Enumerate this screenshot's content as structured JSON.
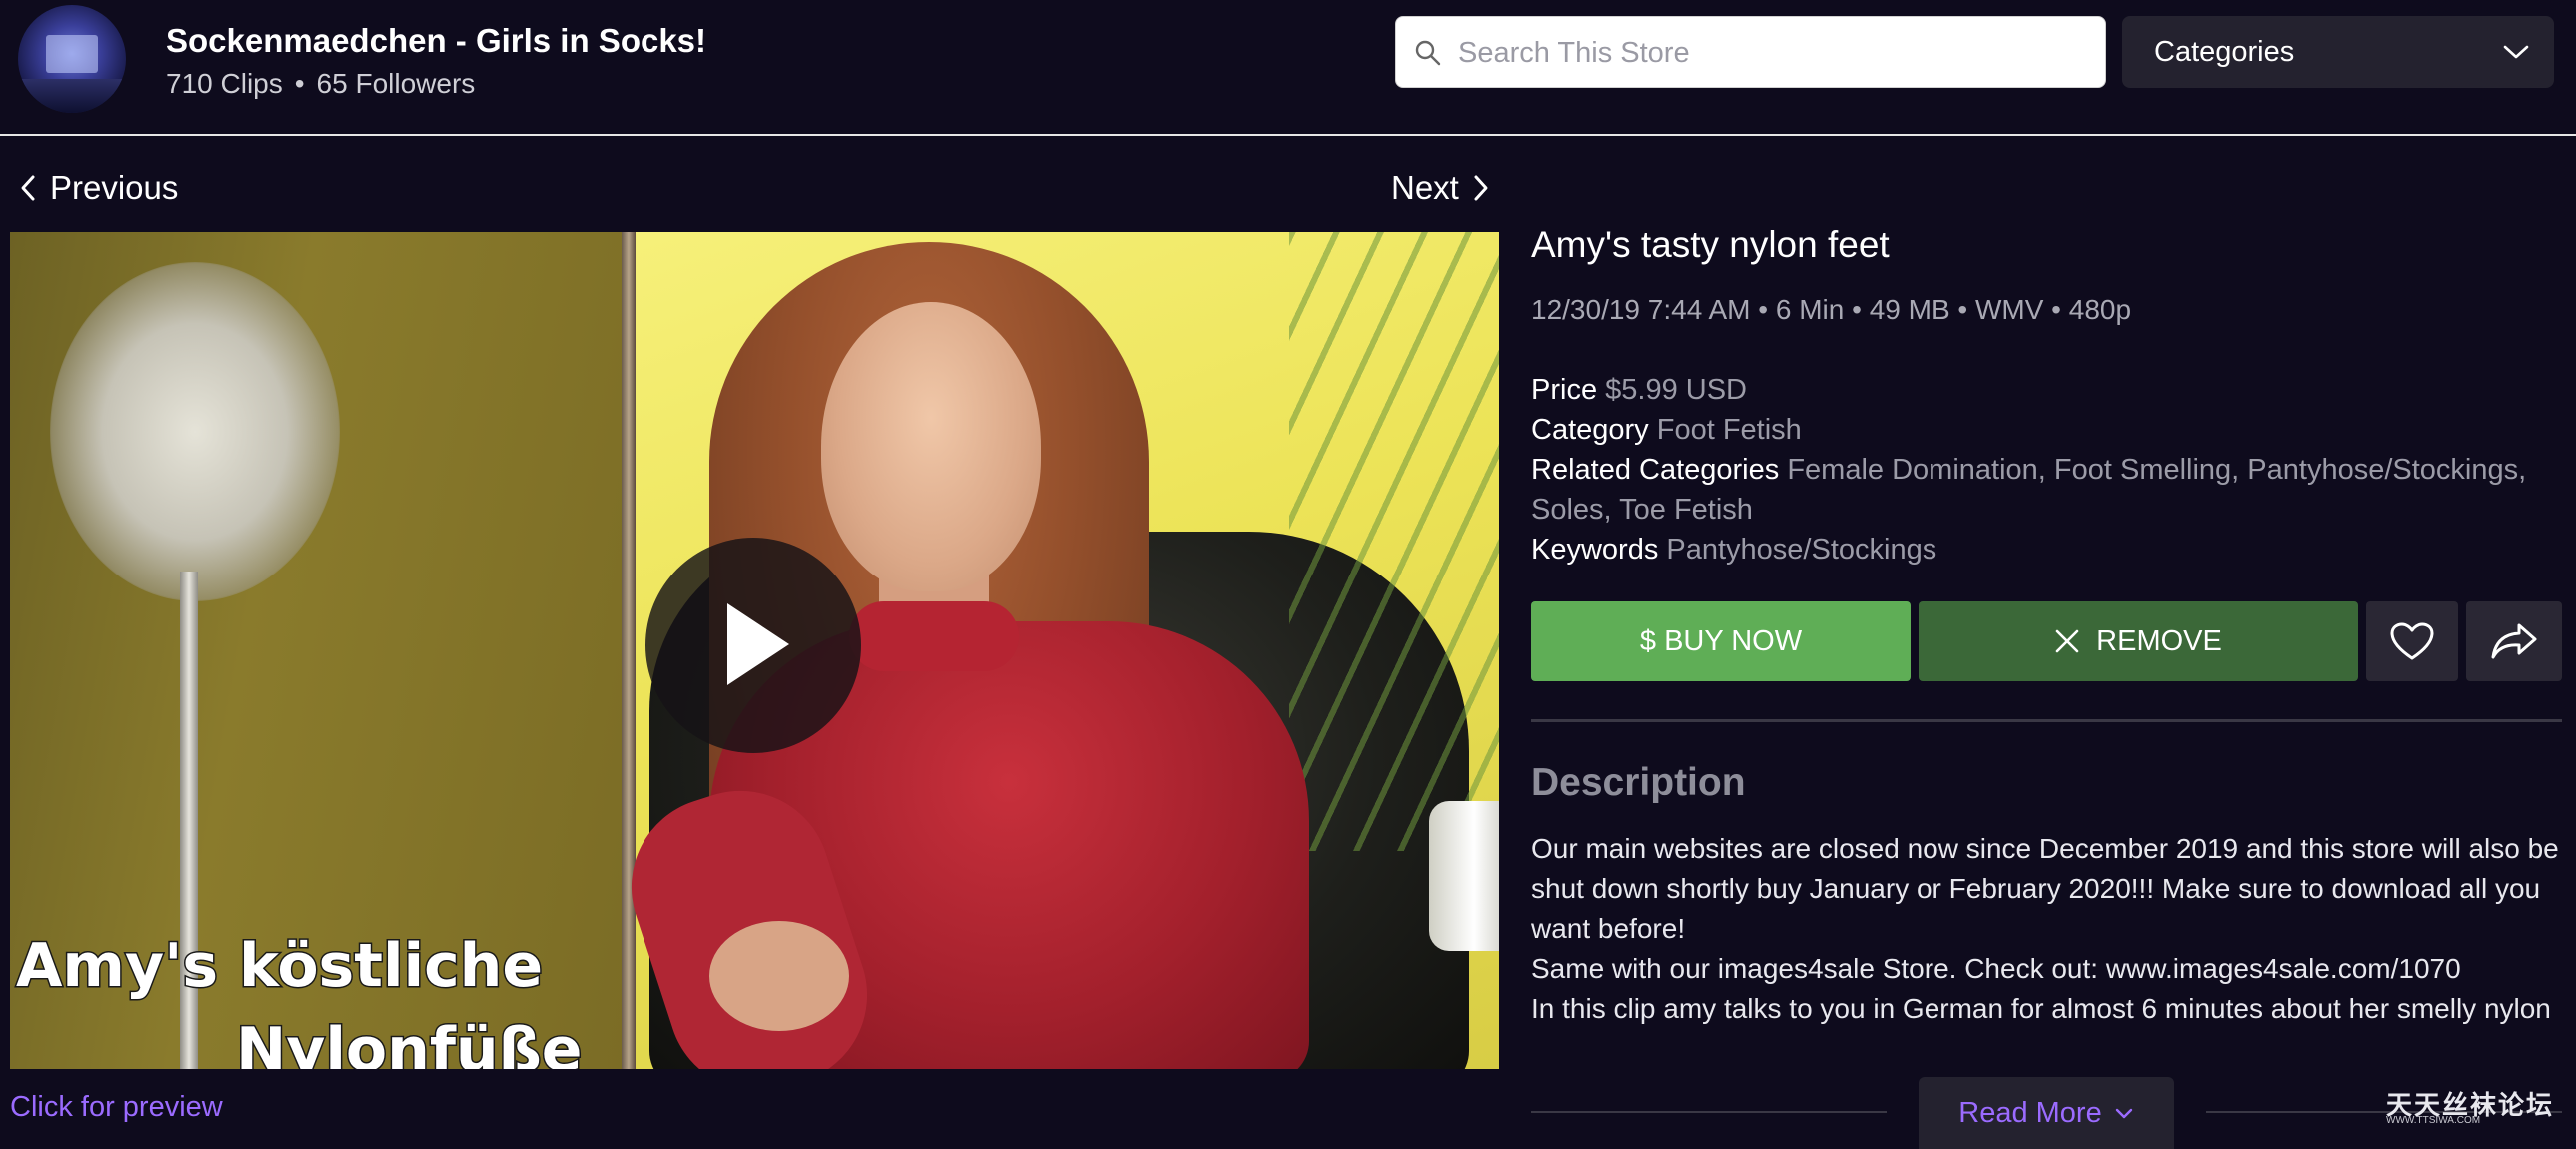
{
  "header": {
    "store_name": "Sockenmaedchen - Girls in Socks!",
    "clips": "710 Clips",
    "separator": "•",
    "followers": "65 Followers",
    "search_placeholder": "Search This Store",
    "categories_label": "Categories"
  },
  "nav": {
    "previous": "Previous",
    "next": "Next"
  },
  "video": {
    "caption_line1": "Amy's köstliche",
    "caption_line2": "Nylonfüße",
    "preview_link": "Click for preview"
  },
  "clip": {
    "title": "Amy's tasty nylon feet",
    "meta": "12/30/19 7:44 AM • 6 Min • 49 MB • WMV • 480p",
    "price_label": "Price",
    "price_value": "$5.99 USD",
    "category_label": "Category",
    "category_value": "Foot Fetish",
    "related_label": "Related Categories",
    "related_value": "Female Domination, Foot Smelling, Pantyhose/Stockings, Soles, Toe Fetish",
    "keywords_label": "Keywords",
    "keywords_value": "Pantyhose/Stockings"
  },
  "actions": {
    "buy_now": "$ BUY NOW",
    "remove": "REMOVE"
  },
  "description": {
    "heading": "Description",
    "lines": [
      "Our main websites are closed now since December 2019 and this store will also be shut down shortly buy January or February 2020!!! Make sure to download all you want before!",
      "Same with our images4sale Store. Check out: www.images4sale.com/1070",
      "In this clip amy talks to you in German for almost 6 minutes about her smelly nylon"
    ],
    "read_more": "Read More"
  },
  "watermark": {
    "text": "天天丝袜论坛",
    "sub": "WWW.TTSIWA.COM"
  },
  "colors": {
    "background": "#0e0b1d",
    "buy_green": "#5fae56",
    "remove_green": "#3b6838",
    "link_purple": "#9b6bff"
  }
}
